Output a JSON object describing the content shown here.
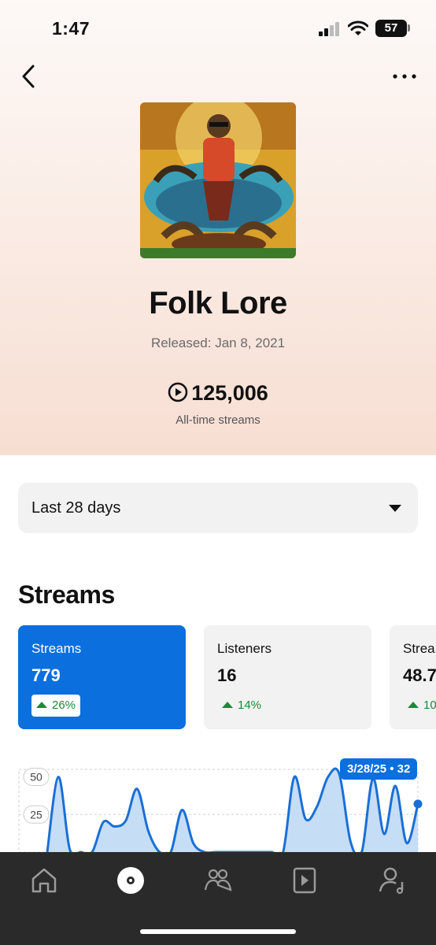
{
  "status_bar": {
    "time": "1:47",
    "battery": "57"
  },
  "header": {
    "back_icon": "chevron-left-icon",
    "more_icon": "more-dots-icon"
  },
  "release": {
    "title": "Folk Lore",
    "released": "Released: Jan 8, 2021",
    "streams_total": "125,006",
    "streams_caption": "All-time streams"
  },
  "filter": {
    "selected": "Last 28 days"
  },
  "section": {
    "title": "Streams"
  },
  "cards": [
    {
      "label": "Streams",
      "value": "779",
      "delta": "26%",
      "active": true
    },
    {
      "label": "Listeners",
      "value": "16",
      "delta": "14%",
      "active": false
    },
    {
      "label": "Strea",
      "value": "48.7",
      "delta": "10",
      "active": false
    }
  ],
  "chart_data": {
    "type": "area",
    "y_ticks": [
      "50",
      "25"
    ],
    "ylim": [
      0,
      55
    ],
    "values": [
      0,
      50,
      2,
      0,
      0,
      20,
      17,
      21,
      42,
      14,
      0,
      0,
      28,
      6,
      0,
      0,
      0,
      0,
      0,
      0,
      0,
      0,
      50,
      22,
      30,
      50,
      52,
      7,
      0,
      49,
      12,
      44,
      6,
      32
    ],
    "tooltip": {
      "date": "3/28/25",
      "value": "32"
    }
  },
  "chart": {
    "tooltip_text": "3/28/25 • 32"
  },
  "tabbar": {
    "items": [
      "home-icon",
      "catalog-disc-icon",
      "audience-icon",
      "video-icon",
      "profile-music-icon"
    ]
  },
  "colors": {
    "accent": "#0b6fde",
    "positive": "#1a8a3a",
    "tabbar": "#2a2a2a"
  }
}
